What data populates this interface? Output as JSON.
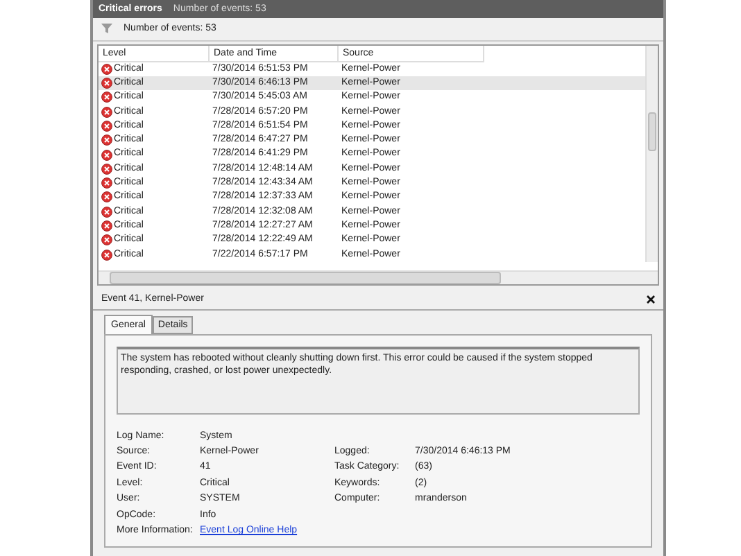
{
  "header": {
    "title": "Critical errors",
    "count": "Number of events: 53"
  },
  "filter": {
    "label": "Number of events: 53"
  },
  "table": {
    "columns": [
      "Level",
      "Date and Time",
      "Source"
    ],
    "rows": [
      {
        "level": "Critical",
        "date": "7/30/2014 6:51:53 PM",
        "source": "Kernel-Power",
        "selected": false
      },
      {
        "level": "Critical",
        "date": "7/30/2014 6:46:13 PM",
        "source": "Kernel-Power",
        "selected": true
      },
      {
        "level": "Critical",
        "date": "7/30/2014 5:45:03 AM",
        "source": "Kernel-Power",
        "selected": false
      },
      {
        "level": "Critical",
        "date": "7/28/2014 6:57:20 PM",
        "source": "Kernel-Power",
        "selected": false
      },
      {
        "level": "Critical",
        "date": "7/28/2014 6:51:54 PM",
        "source": "Kernel-Power",
        "selected": false
      },
      {
        "level": "Critical",
        "date": "7/28/2014 6:47:27 PM",
        "source": "Kernel-Power",
        "selected": false
      },
      {
        "level": "Critical",
        "date": "7/28/2014 6:41:29 PM",
        "source": "Kernel-Power",
        "selected": false
      },
      {
        "level": "Critical",
        "date": "7/28/2014 12:48:14 AM",
        "source": "Kernel-Power",
        "selected": false
      },
      {
        "level": "Critical",
        "date": "7/28/2014 12:43:34 AM",
        "source": "Kernel-Power",
        "selected": false
      },
      {
        "level": "Critical",
        "date": "7/28/2014 12:37:33 AM",
        "source": "Kernel-Power",
        "selected": false
      },
      {
        "level": "Critical",
        "date": "7/28/2014 12:32:08 AM",
        "source": "Kernel-Power",
        "selected": false
      },
      {
        "level": "Critical",
        "date": "7/28/2014 12:27:27 AM",
        "source": "Kernel-Power",
        "selected": false
      },
      {
        "level": "Critical",
        "date": "7/28/2014 12:22:49 AM",
        "source": "Kernel-Power",
        "selected": false
      },
      {
        "level": "Critical",
        "date": "7/22/2014 6:57:17 PM",
        "source": "Kernel-Power",
        "selected": false
      }
    ]
  },
  "details": {
    "title": "Event 41, Kernel-Power",
    "tabs": [
      {
        "label": "General",
        "selected": true
      },
      {
        "label": "Details",
        "selected": false
      }
    ],
    "description": "The system has rebooted without cleanly shutting down first. This error could be caused if the system stopped responding, crashed, or lost power unexpectedly.",
    "fields_left": [
      {
        "label": "Log Name:",
        "value": "System"
      },
      {
        "label": "Source:",
        "value": "Kernel-Power"
      },
      {
        "label": "Event ID:",
        "value": "41"
      },
      {
        "label": "Level:",
        "value": "Critical"
      },
      {
        "label": "User:",
        "value": "SYSTEM"
      },
      {
        "label": "OpCode:",
        "value": "Info"
      }
    ],
    "fields_right": [
      {
        "label": "Logged:",
        "value": "7/30/2014 6:46:13 PM"
      },
      {
        "label": "Task Category:",
        "value": "(63)"
      },
      {
        "label": "Keywords:",
        "value": "(2)"
      },
      {
        "label": "Computer:",
        "value": "mranderson"
      }
    ],
    "more_info": {
      "label": "More Information:",
      "link": "Event Log Online Help"
    }
  }
}
